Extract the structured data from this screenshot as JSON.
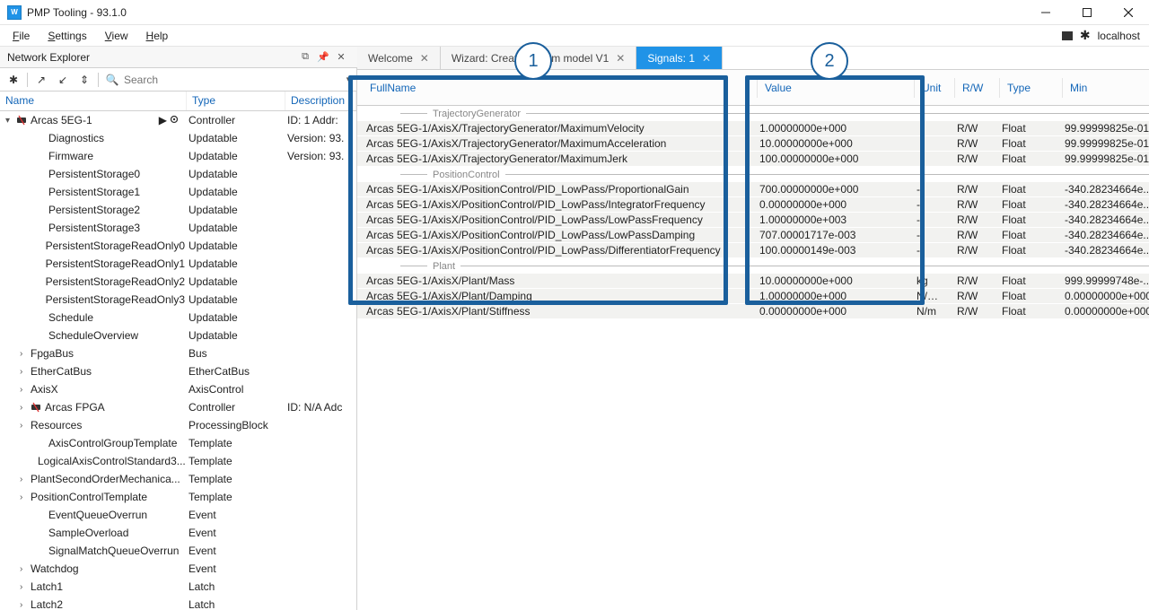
{
  "app": {
    "icon_text": "W",
    "title": "PMP Tooling - 93.1.0"
  },
  "menu": {
    "file": "File",
    "settings": "Settings",
    "view": "View",
    "help": "Help",
    "connection": "localhost"
  },
  "explorer": {
    "panel_title": "Network Explorer",
    "search_placeholder": "Search",
    "columns": {
      "name": "Name",
      "type": "Type",
      "desc": "Description"
    }
  },
  "tree": [
    {
      "indent": 0,
      "expander": "▾",
      "icon": "controller",
      "name": "Arcas 5EG-1",
      "type": "Controller",
      "desc": "ID: 1 Addr:",
      "actions": true
    },
    {
      "indent": 2,
      "name": "Diagnostics",
      "type": "Updatable",
      "desc": "Version: 93."
    },
    {
      "indent": 2,
      "name": "Firmware",
      "type": "Updatable",
      "desc": "Version: 93."
    },
    {
      "indent": 2,
      "name": "PersistentStorage0",
      "type": "Updatable",
      "desc": ""
    },
    {
      "indent": 2,
      "name": "PersistentStorage1",
      "type": "Updatable",
      "desc": ""
    },
    {
      "indent": 2,
      "name": "PersistentStorage2",
      "type": "Updatable",
      "desc": ""
    },
    {
      "indent": 2,
      "name": "PersistentStorage3",
      "type": "Updatable",
      "desc": ""
    },
    {
      "indent": 2,
      "name": "PersistentStorageReadOnly0",
      "type": "Updatable",
      "desc": ""
    },
    {
      "indent": 2,
      "name": "PersistentStorageReadOnly1",
      "type": "Updatable",
      "desc": ""
    },
    {
      "indent": 2,
      "name": "PersistentStorageReadOnly2",
      "type": "Updatable",
      "desc": ""
    },
    {
      "indent": 2,
      "name": "PersistentStorageReadOnly3",
      "type": "Updatable",
      "desc": ""
    },
    {
      "indent": 2,
      "name": "Schedule",
      "type": "Updatable",
      "desc": ""
    },
    {
      "indent": 2,
      "name": "ScheduleOverview",
      "type": "Updatable",
      "desc": ""
    },
    {
      "indent": 1,
      "expander": "›",
      "name": "FpgaBus",
      "type": "Bus",
      "desc": ""
    },
    {
      "indent": 1,
      "expander": "›",
      "name": "EtherCatBus",
      "type": "EtherCatBus",
      "desc": ""
    },
    {
      "indent": 1,
      "expander": "›",
      "name": "AxisX",
      "type": "AxisControl",
      "desc": ""
    },
    {
      "indent": 1,
      "expander": "›",
      "icon": "controller",
      "name": "Arcas FPGA",
      "type": "Controller",
      "desc": "ID: N/A Adc"
    },
    {
      "indent": 1,
      "expander": "›",
      "name": "Resources",
      "type": "ProcessingBlock",
      "desc": ""
    },
    {
      "indent": 2,
      "name": "AxisControlGroupTemplate",
      "type": "Template",
      "desc": ""
    },
    {
      "indent": 2,
      "name": "LogicalAxisControlStandard3...",
      "type": "Template",
      "desc": ""
    },
    {
      "indent": 1,
      "expander": "›",
      "name": "PlantSecondOrderMechanica...",
      "type": "Template",
      "desc": ""
    },
    {
      "indent": 1,
      "expander": "›",
      "name": "PositionControlTemplate",
      "type": "Template",
      "desc": ""
    },
    {
      "indent": 2,
      "name": "EventQueueOverrun",
      "type": "Event",
      "desc": ""
    },
    {
      "indent": 2,
      "name": "SampleOverload",
      "type": "Event",
      "desc": ""
    },
    {
      "indent": 2,
      "name": "SignalMatchQueueOverrun",
      "type": "Event",
      "desc": ""
    },
    {
      "indent": 1,
      "expander": "›",
      "name": "Watchdog",
      "type": "Event",
      "desc": ""
    },
    {
      "indent": 1,
      "expander": "›",
      "name": "Latch1",
      "type": "Latch",
      "desc": ""
    },
    {
      "indent": 1,
      "expander": "›",
      "name": "Latch2",
      "type": "Latch",
      "desc": ""
    }
  ],
  "tabs": [
    {
      "label": "Welcome",
      "closable": true,
      "active": false
    },
    {
      "label": "Wizard: Create system model V1",
      "closable": true,
      "active": false
    },
    {
      "label": "Signals: 1",
      "closable": true,
      "active": true
    }
  ],
  "grid": {
    "columns": {
      "fullname": "FullName",
      "value": "Value",
      "unit": "Unit",
      "rw": "R/W",
      "type": "Type",
      "min": "Min"
    },
    "groups": [
      {
        "title": "TrajectoryGenerator",
        "rows": [
          {
            "fullname": "Arcas 5EG-1/AxisX/TrajectoryGenerator/MaximumVelocity",
            "value": "1.00000000e+000",
            "unit": "",
            "rw": "R/W",
            "type": "Float",
            "min": "99.99999825e-015"
          },
          {
            "fullname": "Arcas 5EG-1/AxisX/TrajectoryGenerator/MaximumAcceleration",
            "value": "10.00000000e+000",
            "unit": "",
            "rw": "R/W",
            "type": "Float",
            "min": "99.99999825e-015"
          },
          {
            "fullname": "Arcas 5EG-1/AxisX/TrajectoryGenerator/MaximumJerk",
            "value": "100.00000000e+000",
            "unit": "",
            "rw": "R/W",
            "type": "Float",
            "min": "99.99999825e-015"
          }
        ]
      },
      {
        "title": "PositionControl",
        "rows": [
          {
            "fullname": "Arcas 5EG-1/AxisX/PositionControl/PID_LowPass/ProportionalGain",
            "value": "700.00000000e+000",
            "unit": "-",
            "rw": "R/W",
            "type": "Float",
            "min": "-340.28234664e..."
          },
          {
            "fullname": "Arcas 5EG-1/AxisX/PositionControl/PID_LowPass/IntegratorFrequency",
            "value": "0.00000000e+000",
            "unit": "-",
            "rw": "R/W",
            "type": "Float",
            "min": "-340.28234664e..."
          },
          {
            "fullname": "Arcas 5EG-1/AxisX/PositionControl/PID_LowPass/LowPassFrequency",
            "value": "1.00000000e+003",
            "unit": "-",
            "rw": "R/W",
            "type": "Float",
            "min": "-340.28234664e..."
          },
          {
            "fullname": "Arcas 5EG-1/AxisX/PositionControl/PID_LowPass/LowPassDamping",
            "value": "707.00001717e-003",
            "unit": "-",
            "rw": "R/W",
            "type": "Float",
            "min": "-340.28234664e..."
          },
          {
            "fullname": "Arcas 5EG-1/AxisX/PositionControl/PID_LowPass/DifferentiatorFrequency",
            "value": "100.00000149e-003",
            "unit": "-",
            "rw": "R/W",
            "type": "Float",
            "min": "-340.28234664e..."
          }
        ]
      },
      {
        "title": "Plant",
        "rows": [
          {
            "fullname": "Arcas 5EG-1/AxisX/Plant/Mass",
            "value": "10.00000000e+000",
            "unit": "kg",
            "rw": "R/W",
            "type": "Float",
            "min": "999.99999748e-..."
          },
          {
            "fullname": "Arcas 5EG-1/AxisX/Plant/Damping",
            "value": "1.00000000e+000",
            "unit": "N/s/m",
            "rw": "R/W",
            "type": "Float",
            "min": "0.00000000e+000"
          },
          {
            "fullname": "Arcas 5EG-1/AxisX/Plant/Stiffness",
            "value": "0.00000000e+000",
            "unit": "N/m",
            "rw": "R/W",
            "type": "Float",
            "min": "0.00000000e+000"
          }
        ]
      }
    ]
  },
  "callouts": {
    "c1": "1",
    "c2": "2"
  }
}
